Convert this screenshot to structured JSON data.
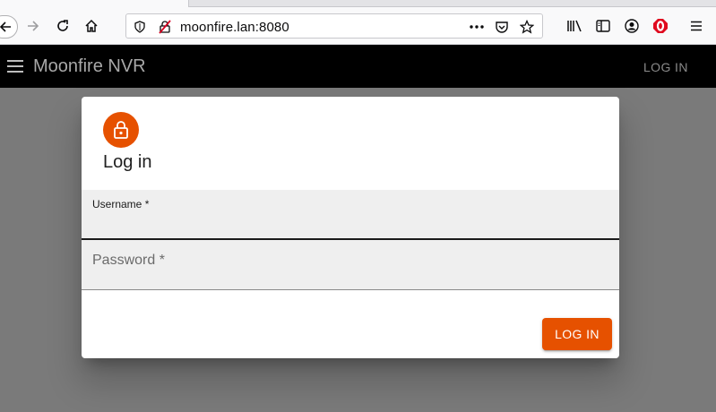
{
  "browser": {
    "url": "moonfire.lan:8080",
    "icons": [
      "back-icon",
      "forward-icon",
      "reload-icon",
      "home-icon",
      "shield-icon",
      "insecure-lock-icon",
      "more-icon",
      "pocket-icon",
      "star-icon",
      "library-icon",
      "sidebar-icon",
      "account-icon",
      "extension-icon",
      "menu-icon"
    ]
  },
  "app_bar": {
    "title": "Moonfire NVR",
    "login_label": "LOG IN"
  },
  "dialog": {
    "title": "Log in",
    "username_label": "Username *",
    "username_value": "",
    "password_label": "Password *",
    "password_value": "",
    "submit_label": "LOG IN"
  },
  "colors": {
    "accent": "#e65100",
    "app_bar": "#000000",
    "backdrop": "#7a7a7a"
  }
}
